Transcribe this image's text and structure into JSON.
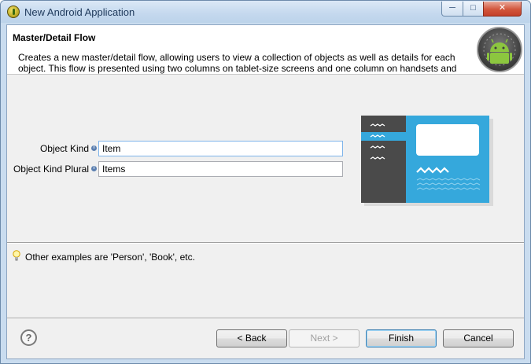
{
  "window": {
    "title": "New Android Application",
    "controls": {
      "minimize": "─",
      "maximize": "□",
      "close": "✕"
    }
  },
  "header": {
    "title": "Master/Detail Flow",
    "description": "Creates a new master/detail flow, allowing users to view a collection of objects as well as details for each object. This flow is presented using two columns on tablet-size screens and one column on handsets and"
  },
  "form": {
    "object_kind": {
      "label": "Object Kind",
      "value": "Item"
    },
    "object_kind_plural": {
      "label": "Object Kind Plural",
      "value": "Items"
    }
  },
  "hint": {
    "text": "Other examples are 'Person', 'Book', etc."
  },
  "buttons": {
    "help": "?",
    "back": "< Back",
    "next": "Next >",
    "finish": "Finish",
    "cancel": "Cancel"
  },
  "colors": {
    "preview_dark": "#4a4a4a",
    "preview_accent": "#35a8dc",
    "android_green": "#8cc63f"
  }
}
